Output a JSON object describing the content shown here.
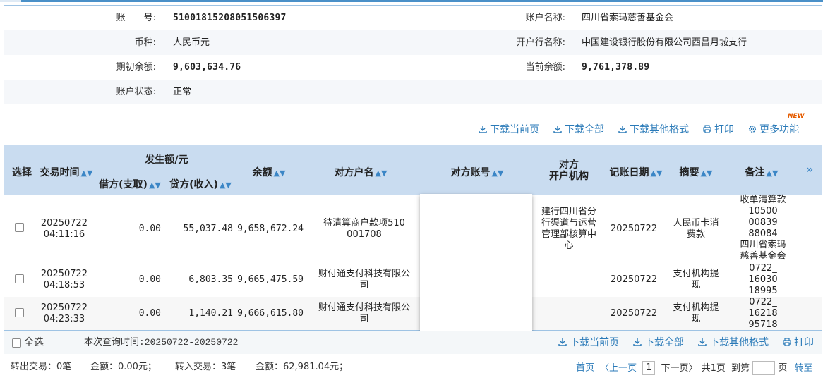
{
  "account": {
    "account_no_label": "账　　号:",
    "account_no": "51001815208051506397",
    "account_name_label": "账户名称:",
    "account_name": "四川省索玛慈善基金会",
    "currency_label": "币种:",
    "currency": "人民币元",
    "bank_label": "开户行名称:",
    "bank": "中国建设银行股份有限公司西昌月城支行",
    "opening_balance_label": "期初余额:",
    "opening_balance": "9,603,634.76",
    "current_balance_label": "当前余额:",
    "current_balance": "9,761,378.89",
    "status_label": "账户状态:",
    "status": "正常"
  },
  "toolbar": {
    "download_page": "下载当前页",
    "download_all": "下载全部",
    "download_other": "下载其他格式",
    "print": "打印",
    "more": "更多功能",
    "new_badge": "NEW"
  },
  "table": {
    "headers": {
      "select": "选择",
      "time": "交易时间",
      "amount_group": "发生额/元",
      "debit": "借方(支取)",
      "credit": "贷方(收入)",
      "balance": "余额",
      "counterparty_name": "对方户名",
      "counterparty_account": "对方账号",
      "counterparty_bank_line1": "对方",
      "counterparty_bank_line2": "开户机构",
      "post_date": "记账日期",
      "summary": "摘要",
      "remark": "备注",
      "more_arrow": "»"
    },
    "rows": [
      {
        "date": "20250722",
        "time": "04:11:16",
        "debit": "0.00",
        "credit": "55,037.48",
        "balance": "9,658,672.24",
        "counterparty_name_1": "待清算商户款项510",
        "counterparty_name_2": "001708",
        "bank_1": "建行四川省分",
        "bank_2": "行渠道与运营",
        "bank_3": "管理部核算中",
        "bank_4": "心",
        "post_date": "20250722",
        "summary_1": "人民币卡消",
        "summary_2": "费款",
        "remark_1": "收单清算款",
        "remark_2": "10500",
        "remark_3": "00839",
        "remark_4": "88084",
        "remark_5": "四川省索玛",
        "remark_6": "慈善基金会"
      },
      {
        "date": "20250722",
        "time": "04:18:53",
        "debit": "0.00",
        "credit": "6,803.35",
        "balance": "9,665,475.59",
        "counterparty_name_1": "财付通支付科技有限公",
        "counterparty_name_2": "司",
        "post_date": "20250722",
        "summary_1": "支付机构提",
        "summary_2": "现",
        "remark_1": "0722_",
        "remark_2": "16030",
        "remark_3": "18995"
      },
      {
        "date": "20250722",
        "time": "04:23:33",
        "debit": "0.00",
        "credit": "1,140.21",
        "balance": "9,666,615.80",
        "counterparty_name_1": "财付通支付科技有限公",
        "counterparty_name_2": "司",
        "post_date": "20250722",
        "summary_1": "支付机构提",
        "summary_2": "现",
        "remark_1": "0722_",
        "remark_2": "16218",
        "remark_3": "95718"
      }
    ]
  },
  "footer": {
    "select_all": "全选",
    "query_time": "本次查询时间:20250722-20250722",
    "download_page": "下载当前页",
    "download_all": "下载全部",
    "download_other": "下载其他格式",
    "print": "打印",
    "out_count": "转出交易：0笔",
    "out_amount": "金额：0.00元；",
    "in_count": "转入交易：3笔",
    "in_amount": "金额：62,981.04元；",
    "first": "首页",
    "prev": "〈上一页",
    "page": "1",
    "next": "下一页〉",
    "total": "共1页",
    "goto_label": "到第",
    "page_unit": "页",
    "go": "转至"
  }
}
